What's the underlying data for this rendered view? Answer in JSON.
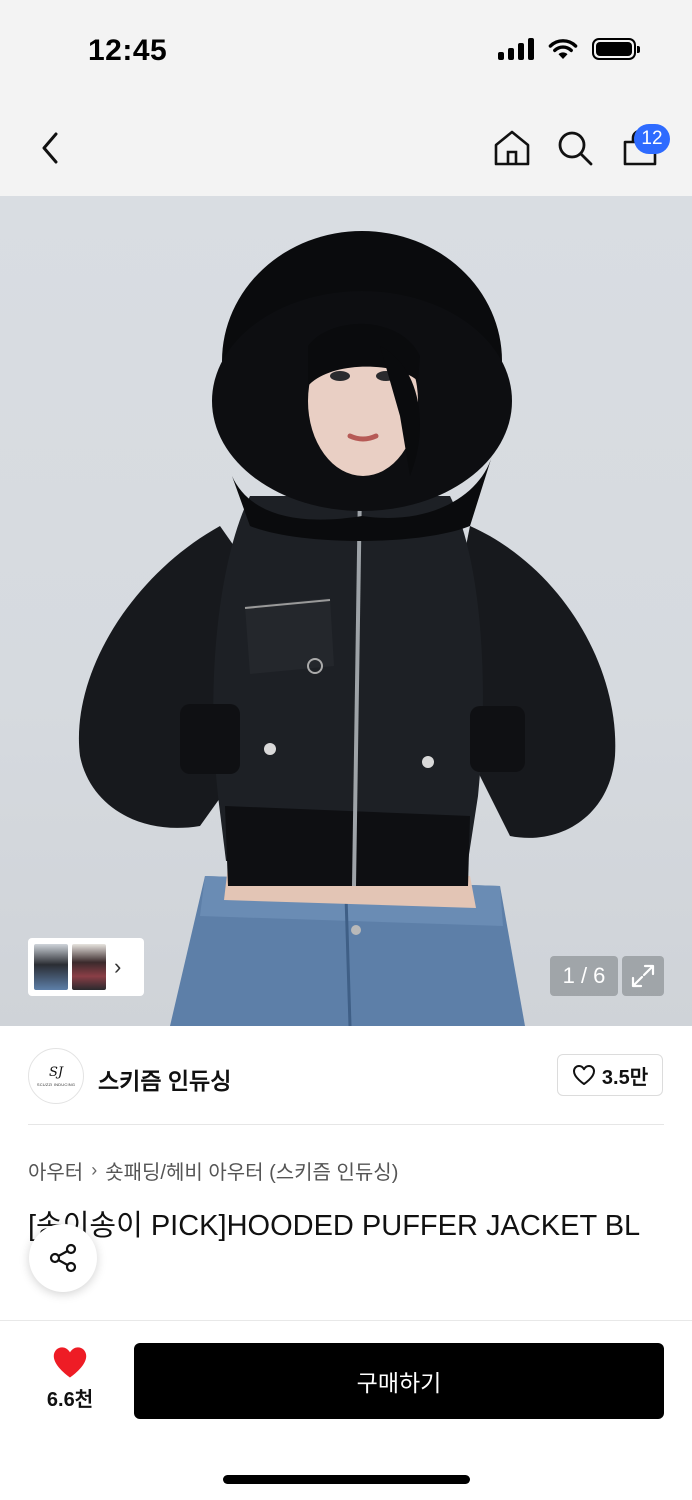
{
  "status_bar": {
    "time": "12:45"
  },
  "nav": {
    "icons": [
      "chevron-left-icon",
      "home-icon",
      "search-icon",
      "shopping-bag-icon"
    ],
    "cart_badge": "12"
  },
  "gallery": {
    "counter": "1 / 6",
    "thumbnail_arrow": "›"
  },
  "brand": {
    "logo_text": "SJ",
    "logo_subtext": "SCUZZI INDUCING",
    "name": "스키즘 인듀싱",
    "likes": "3.5만"
  },
  "breadcrumb": [
    "아우터",
    "숏패딩/헤비 아우터 (스키즘 인듀싱)"
  ],
  "product": {
    "title": "[송이송이 PICK]HOODED PUFFER JACKET BL"
  },
  "bottom_bar": {
    "wish_count": "6.6천",
    "buy_label": "구매하기"
  },
  "colors": {
    "accent_blue": "#2e6bff",
    "heart_red": "#ee1c25",
    "buy_button": "#000000"
  }
}
